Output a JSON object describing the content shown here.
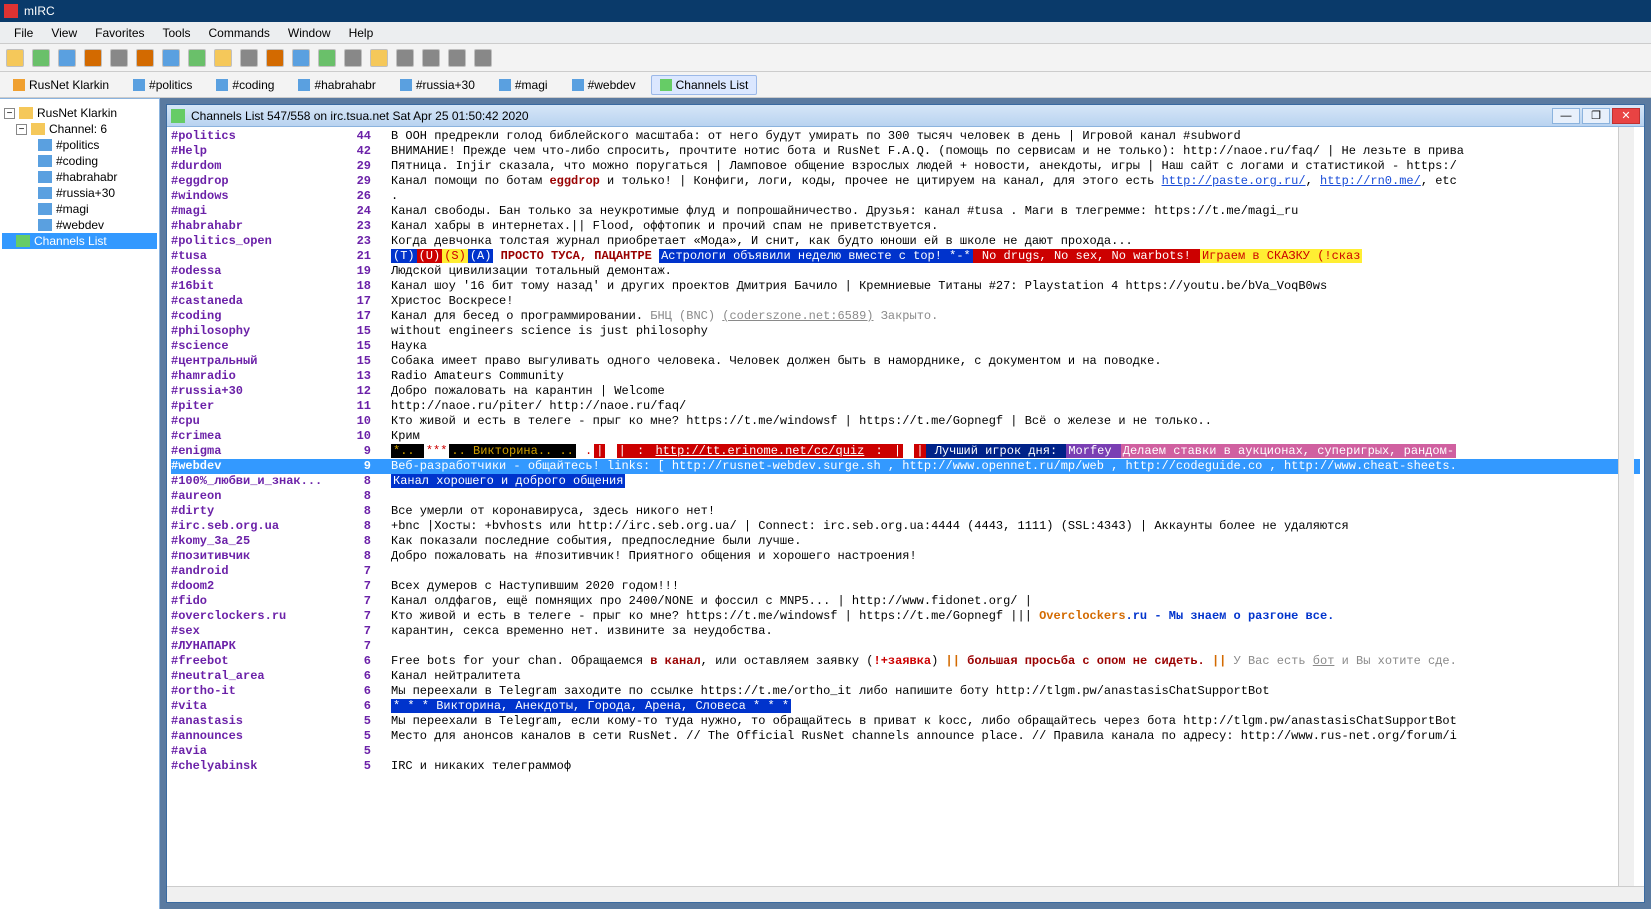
{
  "title": "mIRC",
  "menu": [
    "File",
    "View",
    "Favorites",
    "Tools",
    "Commands",
    "Window",
    "Help"
  ],
  "tabs": [
    {
      "label": "RusNet Klarkin",
      "icon": "net",
      "active": false
    },
    {
      "label": "#politics",
      "icon": "chan",
      "active": false
    },
    {
      "label": "#coding",
      "icon": "chan",
      "active": false
    },
    {
      "label": "#habrahabr",
      "icon": "chan",
      "active": false
    },
    {
      "label": "#russia+30",
      "icon": "chan",
      "active": false
    },
    {
      "label": "#magi",
      "icon": "chan",
      "active": false
    },
    {
      "label": "#webdev",
      "icon": "chan",
      "active": false
    },
    {
      "label": "Channels List",
      "icon": "list",
      "active": true
    }
  ],
  "tree": {
    "root": "RusNet Klarkin",
    "group": "Channel: 6",
    "items": [
      "#politics",
      "#coding",
      "#habrahabr",
      "#russia+30",
      "#magi",
      "#webdev"
    ],
    "selected": "Channels List"
  },
  "win": {
    "title": "Channels List 547/558 on irc.tsua.net Sat Apr 25 01:50:42 2020"
  },
  "rows": [
    {
      "n": "#politics",
      "c": "44",
      "t": "В ООН предрекли голод библейского масштаба: от него будут умирать по 300 тысяч человек в день | Игровой канал #subword"
    },
    {
      "n": "#Help",
      "c": "42",
      "t": "ВНИМАНИЕ! Прежде чем что-либо спросить, прочтите нотис бота и RusNet F.A.Q. (помощь по сервисам и не только): http://naoe.ru/faq/ | Не лезьте в прива"
    },
    {
      "n": "#durdom",
      "c": "29",
      "t": "Пятница. Injir сказала, что можно поругаться | Ламповое общение взрослых людей + новости, анекдоты, игры | Наш сайт с логами и статистикой - https:/"
    },
    {
      "n": "#eggdrop",
      "c": "29",
      "segs": [
        {
          "txt": "Канал помощи по ботам "
        },
        {
          "txt": "eggdrop",
          "cls": "maroon"
        },
        {
          "txt": " и только! | Конфиги, логи, коды, прочее не цитируем на канал, для этого есть "
        },
        {
          "txt": "http://paste.org.ru/",
          "cls": "link"
        },
        {
          "txt": ", "
        },
        {
          "txt": "http://rn0.me/",
          "cls": "link"
        },
        {
          "txt": ", etc"
        }
      ]
    },
    {
      "n": "#windows",
      "c": "26",
      "t": "."
    },
    {
      "n": "#magi",
      "c": "24",
      "t": "Канал свободы. Бан только за неукротимые флуд и попрошайничество. Друзья: канал #tusa . Маги в тлегремме: https://t.me/magi_ru"
    },
    {
      "n": "#habrahabr",
      "c": "23",
      "t": "Канал хабры в интернетах.|| Flood, оффтопик и прочий спам не приветствуется."
    },
    {
      "n": "#politics_open",
      "c": "23",
      "t": "Когда девчонка толстая журнал приобретает «Мода», И снит, как будто юноши ей в школе не дают прохода..."
    },
    {
      "n": "#tusa",
      "c": "21",
      "segs": [
        {
          "txt": "(T)",
          "cls": "seg bg-blue"
        },
        {
          "txt": "(U)",
          "cls": "seg bg-red"
        },
        {
          "txt": "(S)",
          "cls": "seg bg-yellow"
        },
        {
          "txt": "(A)",
          "cls": "seg bg-blue"
        },
        {
          "txt": " ПРОСТО ТУСА, ПАЦАНТРЕ ",
          "cls": "maroon"
        },
        {
          "txt": "Астрологи объявили неделю вместе с top! *-*",
          "cls": "seg bg-blue"
        },
        {
          "txt": " No drugs, No sex, No warbots! ",
          "cls": "seg bg-red"
        },
        {
          "txt": "Играем в СКАЗКУ (!сказ",
          "cls": "seg bg-yellow"
        }
      ]
    },
    {
      "n": "#odessa",
      "c": "19",
      "t": "Людской цивилизации тотальный демонтаж."
    },
    {
      "n": "#16bit",
      "c": "18",
      "t": "Канал шоу '16 бит тому назад' и других проектов Дмитрия Бачило | Кремниевые Титаны #27:  Playstation 4 https://youtu.be/bVa_VoqB0ws"
    },
    {
      "n": "#castaneda",
      "c": "17",
      "t": "Христос Воскресе!"
    },
    {
      "n": "#coding",
      "c": "17",
      "segs": [
        {
          "txt": "Канал для бесед о программировании. "
        },
        {
          "txt": "БНЦ (BNC) ",
          "cls": "grey"
        },
        {
          "txt": "(coderszone.net:6589)",
          "cls": "grey link"
        },
        {
          "txt": " Закрыто.",
          "cls": "grey"
        }
      ]
    },
    {
      "n": "#philosophy",
      "c": "15",
      "t": "without engineers science is just philosophy"
    },
    {
      "n": "#science",
      "c": "15",
      "t": "Наука"
    },
    {
      "n": "#центральный",
      "c": "15",
      "t": "Собака имеет право выгуливать одного человека. Человек должен быть в наморднике, с документом и на поводке."
    },
    {
      "n": "#hamradio",
      "c": "13",
      "t": "Radio Amateurs Community"
    },
    {
      "n": "#russia+30",
      "c": "12",
      "t": "Добро пожаловать на карантин | Welcome"
    },
    {
      "n": "#piter",
      "c": "11",
      "t": "http://naoe.ru/piter/ http://naoe.ru/faq/"
    },
    {
      "n": "#cpu",
      "c": "10",
      "t": "Кто живой и есть в телеге - прыг ко мне? https://t.me/windowsf | https://t.me/Gopnegf | Всё о железе и не только.."
    },
    {
      "n": "#crimea",
      "c": "10",
      "t": "Крим"
    },
    {
      "n": "#enigma",
      "c": "9",
      "segs": [
        {
          "txt": " *.. ",
          "cls": "seg bg-black fgmar"
        },
        {
          "txt": "***",
          "cls": "seg bg-white-r"
        },
        {
          "txt": ".. Викторина.. ..",
          "cls": "seg bg-black fgmar"
        },
        {
          "txt": " .",
          "cls": "seg bg-white-r"
        },
        {
          "txt": "|",
          "cls": "seg bg-red"
        },
        {
          "txt": " ",
          "cls": "seg"
        },
        {
          "txt": "|",
          "cls": "seg bg-red"
        },
        {
          "txt": " :  ",
          "cls": "seg bg-red"
        },
        {
          "txt": "http://tt.erinome.net/cc/quiz",
          "cls": "seg bg-red link"
        },
        {
          "txt": "  : ",
          "cls": "seg bg-red"
        },
        {
          "txt": "|",
          "cls": "seg bg-red"
        },
        {
          "txt": " ",
          "cls": "seg"
        },
        {
          "txt": "|",
          "cls": "seg bg-red"
        },
        {
          "txt": " Лучший игрок дня: ",
          "cls": "seg bg-dblue"
        },
        {
          "txt": "Morfey ",
          "cls": "seg bg-purple"
        },
        {
          "txt": " Делаем ставки в аукционах, суперигрыx, рандом-",
          "cls": "seg bg-mag"
        }
      ]
    },
    {
      "n": "#webdev",
      "c": "9",
      "sel": true,
      "t": "Веб-разработчики - общайтесь! links: [ http://rusnet-webdev.surge.sh , http://www.opennet.ru/mp/web , http://codeguide.co , http://www.cheat-sheets."
    },
    {
      "n": "#100%_любви_и_знак...",
      "c": "8",
      "segs": [
        {
          "txt": "Канал хорошего и доброго общения",
          "cls": "seg bg-blue"
        }
      ]
    },
    {
      "n": "#aureon",
      "c": "8",
      "t": ""
    },
    {
      "n": "#dirty",
      "c": "8",
      "t": "Все умерли от коронавируса, здесь никого нет!"
    },
    {
      "n": "#irc.seb.org.ua",
      "c": "8",
      "t": "+bnc |Хосты: +bvhosts или http://irc.seb.org.ua/ | Connect: irc.seb.org.ua:4444 (4443, 1111) (SSL:4343) | Аккаунты более не удаляются"
    },
    {
      "n": "#komy_3a_25",
      "c": "8",
      "t": "Как показали последние события, предпоследние были лучше."
    },
    {
      "n": "#позитивчик",
      "c": "8",
      "t": "Добро пожаловать на #позитивчик! Приятного общения и хорошего настроения!"
    },
    {
      "n": "#android",
      "c": "7",
      "t": ""
    },
    {
      "n": "#doom2",
      "c": "7",
      "t": "Всех думеров с Наступившим 2020 годом!!!"
    },
    {
      "n": "#fido",
      "c": "7",
      "t": "Канал олдфагов, ещё помнящих про 2400/NONE и фоссил с MNP5... | http://www.fidonet.org/ |"
    },
    {
      "n": "#overclockers.ru",
      "c": "7",
      "segs": [
        {
          "txt": "Кто живой и есть в телеге - прыг ко мне? https://t.me/windowsf | https://t.me/Gopnegf ||| "
        },
        {
          "txt": "Overclockers",
          "cls": "orange"
        },
        {
          "txt": ".ru - Мы знаем о разгоне все.",
          "cls": "blue"
        }
      ]
    },
    {
      "n": "#sex",
      "c": "7",
      "t": "карантин, секса временно нет. извините за неудобства."
    },
    {
      "n": "#ЛУНАПАРК",
      "c": "7",
      "t": ""
    },
    {
      "n": "#freebot",
      "c": "6",
      "segs": [
        {
          "txt": "Free bots for your chan. Обращаемся "
        },
        {
          "txt": "в канал",
          "cls": "maroon"
        },
        {
          "txt": ", или оставляем заявку ("
        },
        {
          "txt": "!+заявка",
          "cls": "red"
        },
        {
          "txt": ") "
        },
        {
          "txt": "||",
          "cls": "orange"
        },
        {
          "txt": " большая просьба с опом не сидеть. ",
          "cls": "maroon"
        },
        {
          "txt": "||",
          "cls": "orange"
        },
        {
          "txt": " У Вас есть ",
          "cls": "grey"
        },
        {
          "txt": "бот",
          "cls": "grey link"
        },
        {
          "txt": " и Вы хотите сде.",
          "cls": "grey"
        }
      ]
    },
    {
      "n": "#neutral_area",
      "c": "6",
      "t": "Канал нейтралитета"
    },
    {
      "n": "#ortho-it",
      "c": "6",
      "t": "Мы переехали в Telegram заходите по ссылке https://t.me/ortho_it либо напишите боту http://tlgm.pw/anastasisChatSupportBot"
    },
    {
      "n": "#vita",
      "c": "6",
      "segs": [
        {
          "txt": " * * * Викторина, Анекдоты, Города, Арена, Словеса * * * ",
          "cls": "seg bg-blue"
        }
      ]
    },
    {
      "n": "#anastasis",
      "c": "5",
      "t": "Мы переехали в Telegram, если кому-то туда нужно, то обращайтесь в приват к kocc, либо обращайтесь через бота http://tlgm.pw/anastasisChatSupportBot"
    },
    {
      "n": "#announces",
      "c": "5",
      "t": "Место для анонсов каналов в сети RusNet. // The Official RusNet channels announce place. // Правила канала по адресу: http://www.rus-net.org/forum/i"
    },
    {
      "n": "#avia",
      "c": "5",
      "t": ""
    },
    {
      "n": "#chelyabinsk",
      "c": "5",
      "t": "IRC и никаких телеграммоф"
    }
  ]
}
